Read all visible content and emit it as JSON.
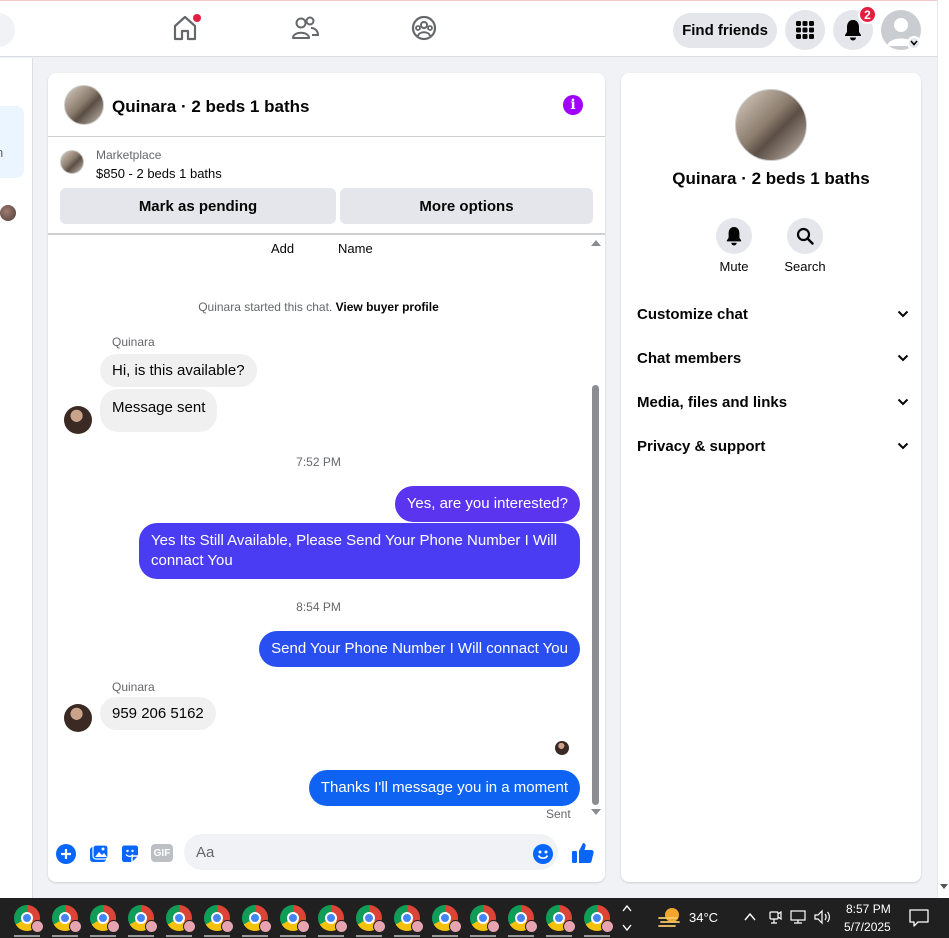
{
  "topbar": {
    "find_friends_label": "Find friends",
    "notifications_count": "2"
  },
  "left_sidebar": {
    "partial_text": "n"
  },
  "chat": {
    "title": "Quinara · 2 beds 1 baths",
    "marketplace_label": "Marketplace",
    "listing_price": "$850 - 2 beds 1 baths",
    "mark_pending_label": "Mark as pending",
    "more_options_label": "More options",
    "add_label": "Add",
    "name_label": "Name",
    "started_text": "Quinara started this chat.",
    "view_profile_label": "View buyer profile",
    "messages": [
      {
        "sender": "Quinara",
        "text": "Hi, is this available?"
      },
      {
        "text": "Message sent"
      },
      {
        "time": "7:52 PM"
      },
      {
        "text": "Yes, are you interested?"
      },
      {
        "text": "Yes Its Still Available, Please Send Your Phone Number I Will connact You"
      },
      {
        "time": "8:54 PM"
      },
      {
        "text": "Send Your Phone Number I Will connact You"
      },
      {
        "sender": "Quinara",
        "text": "959 206 5162"
      },
      {
        "text": "Thanks I'll message you in a moment"
      },
      {
        "status": "Sent"
      }
    ],
    "composer_placeholder": "Aa",
    "gif_label": "GIF"
  },
  "info_panel": {
    "name": "Quinara · 2 beds 1 baths",
    "mute_label": "Mute",
    "search_label": "Search",
    "sections": [
      "Customize chat",
      "Chat members",
      "Media, files and links",
      "Privacy & support"
    ]
  },
  "taskbar": {
    "temperature": "34°C",
    "time": "8:57 PM",
    "date": "5/7/2025"
  },
  "colors": {
    "accent_purple": "#a100ff",
    "bubble_blue": "#1f5cf5",
    "bubble_violet": "#4a3cf2",
    "facebook_blue": "#0866ff"
  }
}
